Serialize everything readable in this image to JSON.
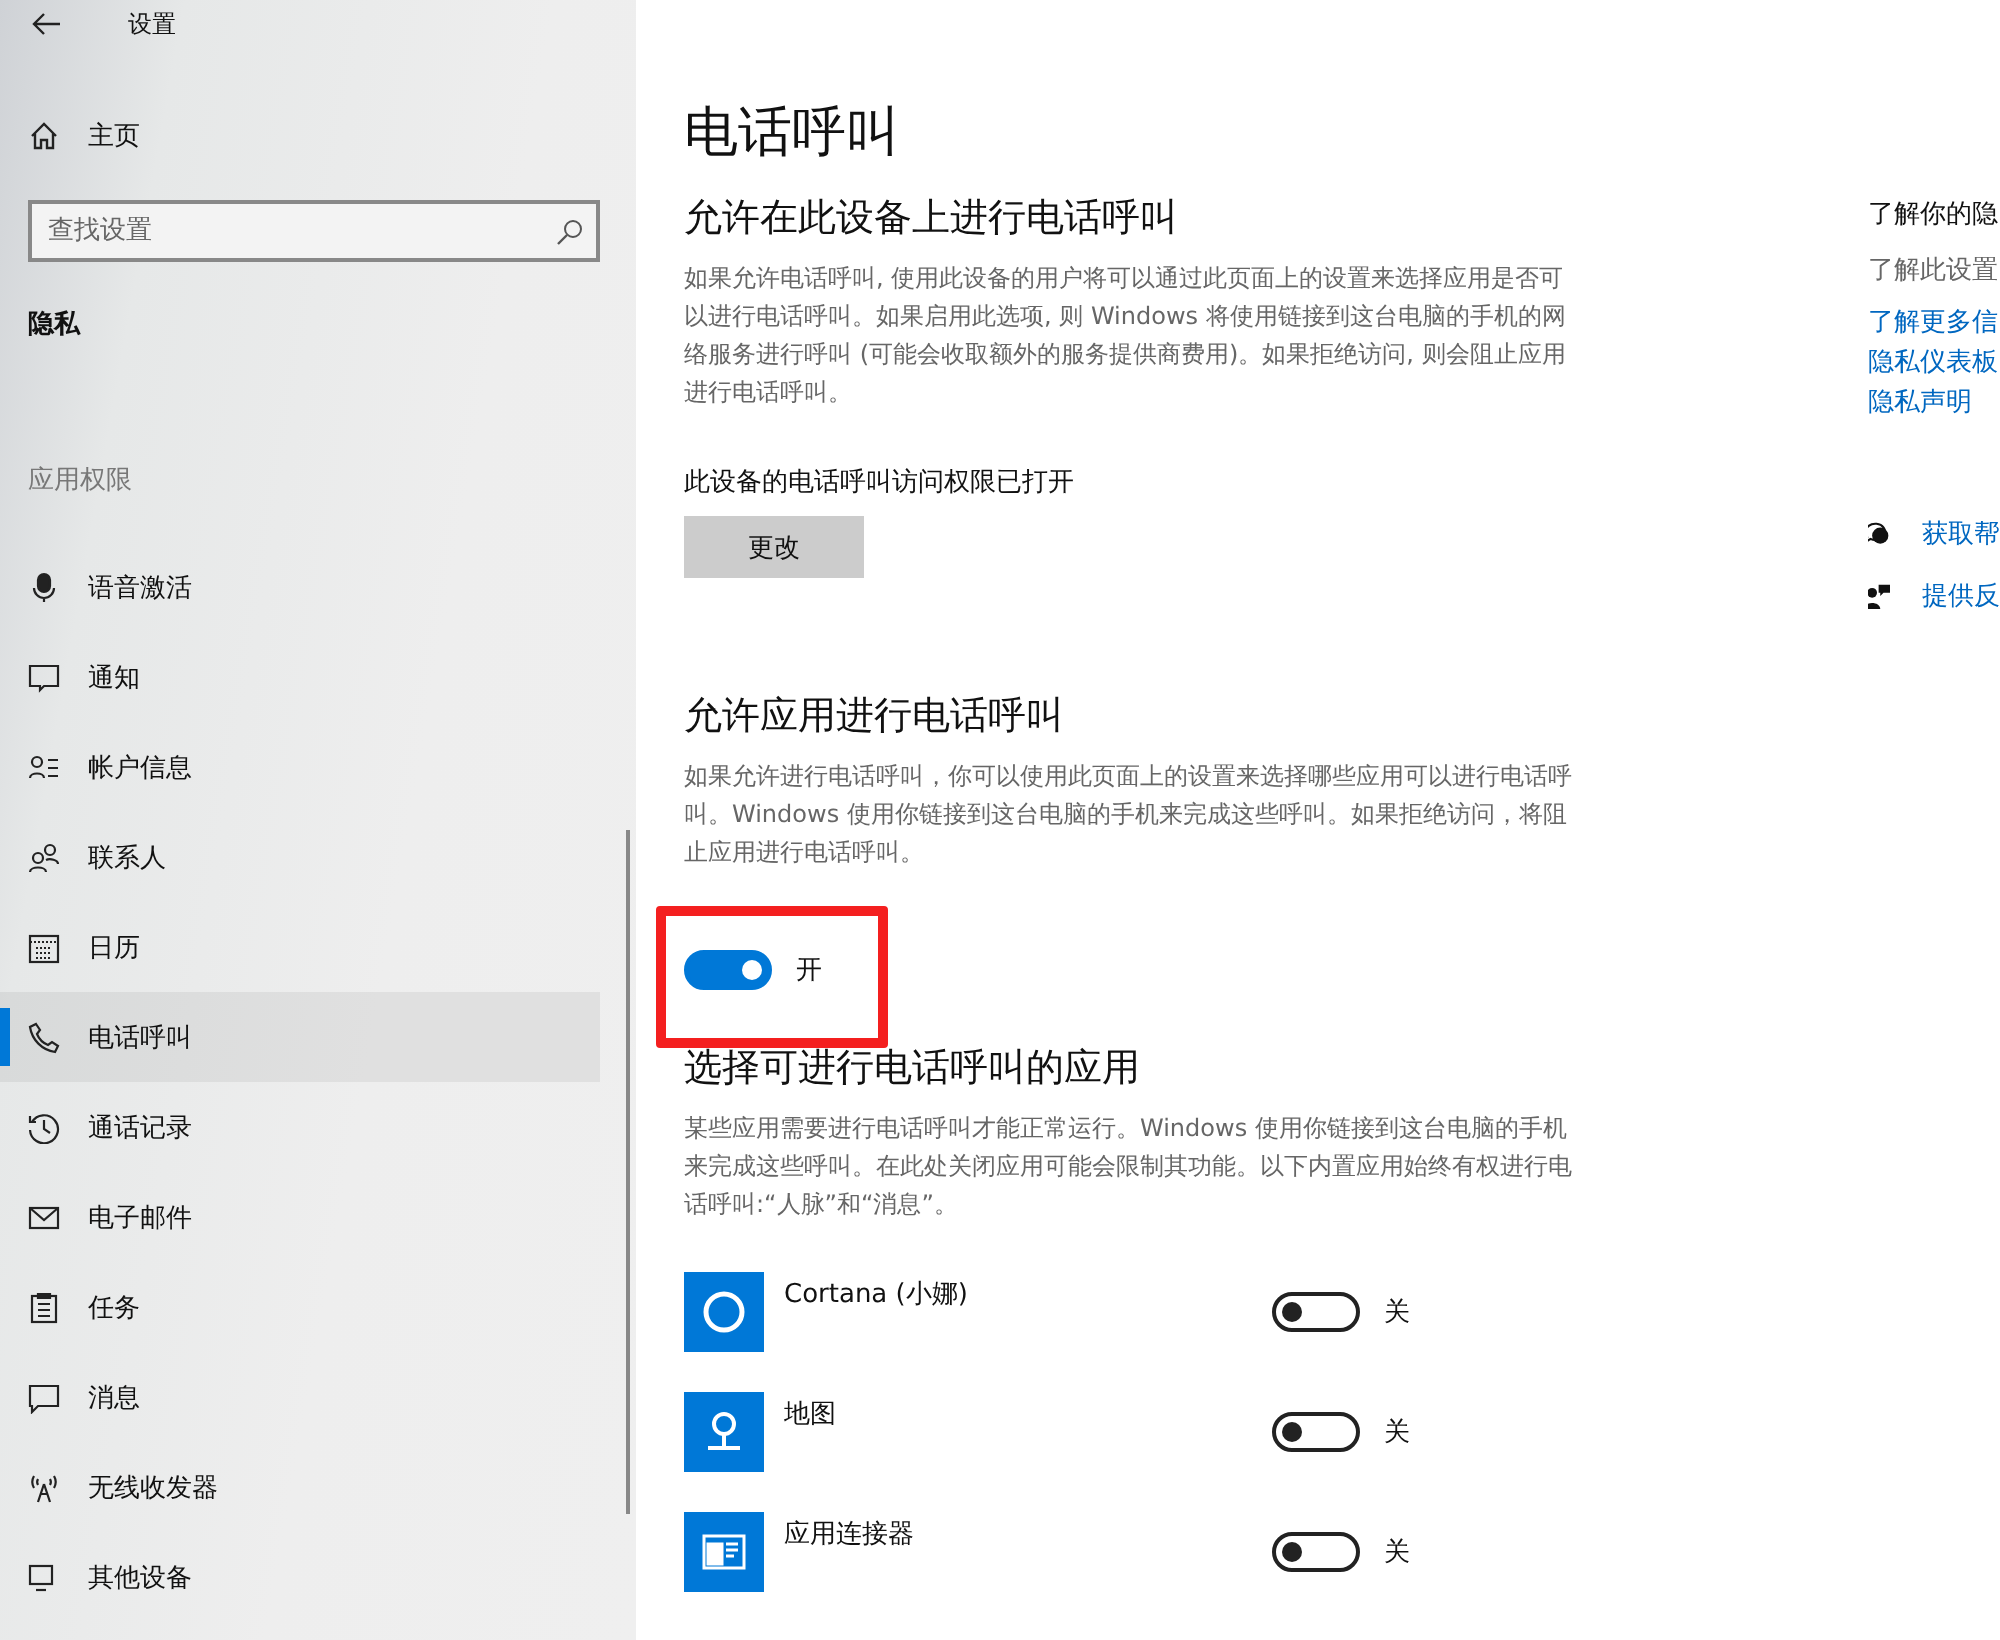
{
  "window": {
    "title": "设置"
  },
  "sidebar": {
    "home": "主页",
    "search": {
      "placeholder": "查找设置"
    },
    "section": "隐私",
    "group": "应用权限",
    "items": [
      {
        "label": "语音激活",
        "selected": false
      },
      {
        "label": "通知",
        "selected": false
      },
      {
        "label": "帐户信息",
        "selected": false
      },
      {
        "label": "联系人",
        "selected": false
      },
      {
        "label": "日历",
        "selected": false
      },
      {
        "label": "电话呼叫",
        "selected": true
      },
      {
        "label": "通话记录",
        "selected": false
      },
      {
        "label": "电子邮件",
        "selected": false
      },
      {
        "label": "任务",
        "selected": false
      },
      {
        "label": "消息",
        "selected": false
      },
      {
        "label": "无线收发器",
        "selected": false
      },
      {
        "label": "其他设备",
        "selected": false
      }
    ]
  },
  "main": {
    "title": "电话呼叫",
    "device_section": {
      "heading": "允许在此设备上进行电话呼叫",
      "description": "如果允许电话呼叫, 使用此设备的用户将可以通过此页面上的设置来选择应用是否可以进行电话呼叫。如果启用此选项, 则 Windows 将使用链接到这台电脑的手机的网络服务进行呼叫 (可能会收取额外的服务提供商费用)。如果拒绝访问, 则会阻止应用进行电话呼叫。",
      "status": "此设备的电话呼叫访问权限已打开",
      "button": "更改"
    },
    "apps_section": {
      "heading": "允许应用进行电话呼叫",
      "description": "如果允许进行电话呼叫，你可以使用此页面上的设置来选择哪些应用可以进行电话呼叫。Windows 使用你链接到这台电脑的手机来完成这些呼叫。如果拒绝访问，将阻止应用进行电话呼叫。",
      "toggle": {
        "on": true,
        "label": "开"
      }
    },
    "choose_section": {
      "heading": "选择可进行电话呼叫的应用",
      "description": "某些应用需要进行电话呼叫才能正常运行。Windows 使用你链接到这台电脑的手机来完成这些呼叫。在此处关闭应用可能会限制其功能。以下内置应用始终有权进行电话呼叫:“人脉”和“消息”。",
      "apps": [
        {
          "name": "Cortana (小娜)",
          "on": false,
          "label": "关"
        },
        {
          "name": "地图",
          "on": false,
          "label": "关"
        },
        {
          "name": "应用连接器",
          "on": false,
          "label": "关"
        }
      ]
    }
  },
  "aside": {
    "heading": "了解你的隐",
    "subtitle": "了解此设置",
    "links": [
      "了解更多信",
      "隐私仪表板",
      "隐私声明"
    ],
    "actions": [
      "获取帮",
      "提供反"
    ]
  }
}
